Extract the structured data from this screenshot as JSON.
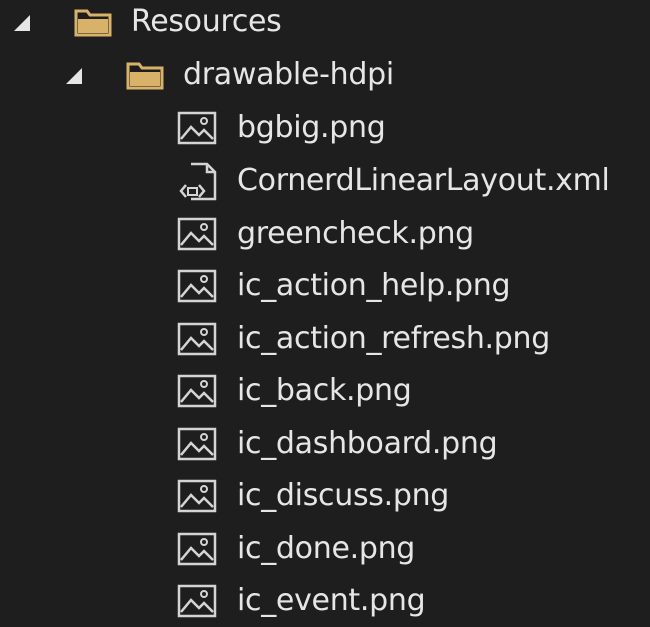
{
  "tree": {
    "root_folder": "Resources",
    "sub_folder": "drawable-hdpi",
    "files": [
      {
        "name": "bgbig.png",
        "icon": "image-file-icon"
      },
      {
        "name": "CornerdLinearLayout.xml",
        "icon": "xml-file-icon"
      },
      {
        "name": "greencheck.png",
        "icon": "image-file-icon"
      },
      {
        "name": "ic_action_help.png",
        "icon": "image-file-icon"
      },
      {
        "name": "ic_action_refresh.png",
        "icon": "image-file-icon"
      },
      {
        "name": "ic_back.png",
        "icon": "image-file-icon"
      },
      {
        "name": "ic_dashboard.png",
        "icon": "image-file-icon"
      },
      {
        "name": "ic_discuss.png",
        "icon": "image-file-icon"
      },
      {
        "name": "ic_done.png",
        "icon": "image-file-icon"
      },
      {
        "name": "ic_event.png",
        "icon": "image-file-icon"
      }
    ]
  },
  "colors": {
    "background": "#1e1e1e",
    "text": "#e6e6e6",
    "folder": "#d9b26a",
    "icon_stroke": "#d4d4d4"
  }
}
